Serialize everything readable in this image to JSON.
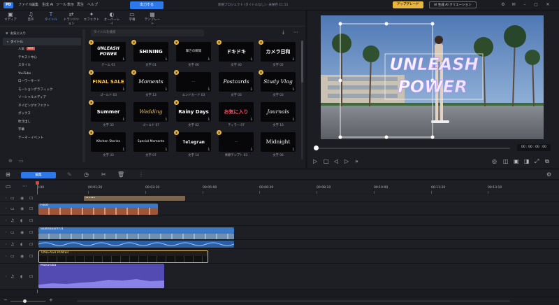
{
  "titlebar": {
    "logo": "PD",
    "menu": [
      "ファイル",
      "編集",
      "生成 AI",
      "ツール",
      "表示",
      "再生",
      "ヘルプ"
    ],
    "export_label": "出力する",
    "project_title": "新規プロジェクト (タイトルなし) - 未保存 11:11",
    "upgrade_label": "アップグレード",
    "ai_creation_label": "AI 生成 AI クリエーション"
  },
  "library": {
    "tabs": [
      {
        "icon": "▣",
        "label": "メディア"
      },
      {
        "icon": "♫",
        "label": "音声"
      },
      {
        "icon": "T",
        "label": "タイトル"
      },
      {
        "icon": "⇄",
        "label": "トランジション"
      },
      {
        "icon": "✦",
        "label": "エフェクト"
      },
      {
        "icon": "◐",
        "label": "オーバーレイ"
      },
      {
        "icon": "▭",
        "label": "字幕"
      },
      {
        "icon": "▦",
        "label": "テンプレート"
      }
    ],
    "search_placeholder": "タイトルを検索",
    "sidebar": [
      {
        "label": "お気に入り",
        "head": true
      },
      {
        "label": "タイトル",
        "head": true,
        "selected": true
      },
      {
        "label": "人気",
        "badge": "HOT"
      },
      {
        "label": "テキスト中心"
      },
      {
        "label": "スタイル"
      },
      {
        "label": "YouTube"
      },
      {
        "label": "ローワーサード"
      },
      {
        "label": "モーショングラフィック"
      },
      {
        "label": "ソーシャルメディア"
      },
      {
        "label": "タイピングエフェクト"
      },
      {
        "label": "ボックス"
      },
      {
        "label": "吹き出し"
      },
      {
        "label": "字幕"
      },
      {
        "label": "テーマ・イベント"
      }
    ],
    "tiles": [
      {
        "text": "UNLEASH POWER",
        "cap": "ゲーム 01",
        "color": "#ffffff",
        "style": "italic"
      },
      {
        "text": "SHINING",
        "cap": "文字 01",
        "color": "#ffffff",
        "style": "bold"
      },
      {
        "text": "輝きの瞬間",
        "cap": "文字 06",
        "color": "#dddddd",
        "style": "thin"
      },
      {
        "text": "ドキドキ",
        "cap": "文字 40",
        "color": "#ffffff",
        "style": "bold"
      },
      {
        "text": "カメラ日和",
        "cap": "文字 02",
        "color": "#ffffff",
        "style": "bold"
      },
      {
        "text": "FINAL SALE",
        "cap": "ゴールド 03",
        "color": "#f2c04f",
        "style": "bold"
      },
      {
        "text": "Moments",
        "cap": "文字 13",
        "color": "#ffffff",
        "style": "script"
      },
      {
        "text": "...",
        "cap": "エンドカード 03",
        "color": "#cccccc",
        "style": "thin"
      },
      {
        "text": "Postcards",
        "cap": "文字 03",
        "color": "#ffffff",
        "style": "script"
      },
      {
        "text": "Study Vlog",
        "cap": "文字 03",
        "color": "#ffffff",
        "style": "script"
      },
      {
        "text": "Summer",
        "cap": "文字 33",
        "color": "#ffffff",
        "style": "bold"
      },
      {
        "text": "Wedding",
        "cap": "ゴールド 07",
        "color": "#e8c46b",
        "style": "script"
      },
      {
        "text": "Rainy Days",
        "cap": "文字 02",
        "color": "#ffffff",
        "style": "bold"
      },
      {
        "text": "お気に入り",
        "cap": "ティラー 07",
        "color": "#ff4d64",
        "style": "bold"
      },
      {
        "text": "Journals",
        "cap": "文字 16",
        "color": "#ffffff",
        "style": "script"
      },
      {
        "text": "Kitchen Stories",
        "cap": "文字 33",
        "color": "#ffffff",
        "style": "thin"
      },
      {
        "text": "Special Moments",
        "cap": "文字 07",
        "color": "#ffffff",
        "style": "thin"
      },
      {
        "text": "Telegram",
        "cap": "文字 14",
        "color": "#ffffff",
        "style": "mono"
      },
      {
        "text": "...",
        "cap": "季節テンプト 03",
        "color": "#cccccc",
        "style": "thin"
      },
      {
        "text": "Midnight",
        "cap": "文字 06",
        "color": "#ffffff",
        "style": "serif"
      }
    ]
  },
  "preview": {
    "overlay_line1": "UNLEASH",
    "overlay_line2": "POWER",
    "timecode": "00 : 00 : 00 : 00",
    "progress": 0
  },
  "timeline": {
    "toolbar": {
      "edit_label": "編集"
    },
    "ticks": [
      "0:00",
      "00:01:20",
      "00:03:10",
      "00:05:00",
      "00:06:20",
      "00:08:10",
      "00:10:00",
      "00:11:20",
      "00:13:10"
    ],
    "clips": {
      "food": "Food",
      "skateboard": "Skateboard 01",
      "title": "UNLEASH POWER",
      "music": "Mahoroba"
    }
  }
}
